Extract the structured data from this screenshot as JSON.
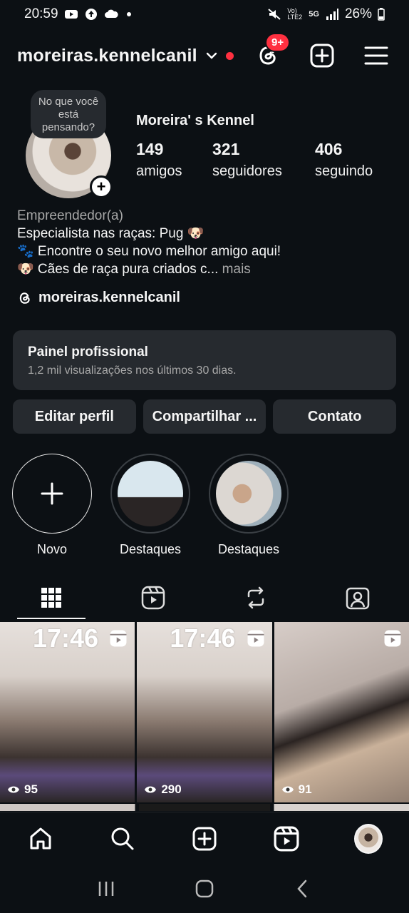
{
  "status_bar": {
    "time": "20:59",
    "battery": "26%",
    "network": "5G",
    "volte": "Vo) LTE2"
  },
  "header": {
    "username": "moreiras.kennelcanil",
    "threads_badge": "9+"
  },
  "profile": {
    "note_placeholder": "No que você está pensando?",
    "name": "Moreira' s Kennel",
    "stats": [
      {
        "value": "149",
        "label": "amigos"
      },
      {
        "value": "321",
        "label": "seguidores"
      },
      {
        "value": "406",
        "label": "seguindo"
      }
    ],
    "category": "Empreendedor(a)",
    "bio_line1": "Especialista nas raças:  Pug 🐶",
    "bio_line2": "🐾 Encontre o seu novo melhor amigo aqui!",
    "bio_line3": "🐶 Cães de raça pura criados c...",
    "bio_more": " mais",
    "threads_handle": "moreiras.kennelcanil"
  },
  "professional_panel": {
    "title": "Painel profissional",
    "subtitle": "1,2 mil visualizações nos últimos 30 dias."
  },
  "buttons": {
    "edit": "Editar perfil",
    "share": "Compartilhar ...",
    "contact": "Contato"
  },
  "highlights": [
    {
      "label": "Novo"
    },
    {
      "label": "Destaques"
    },
    {
      "label": "Destaques"
    }
  ],
  "tabs": [
    "grid-icon",
    "reels-icon",
    "reposts-icon",
    "tagged-icon"
  ],
  "grid": [
    {
      "time": "17:46",
      "views": "95"
    },
    {
      "time": "17:46",
      "views": "290"
    },
    {
      "time": "",
      "views": "91"
    }
  ],
  "colors": {
    "background": "#0c1014",
    "surface": "#262a2f",
    "accent_red": "#ff3040",
    "muted_text": "#a8a8a8"
  }
}
